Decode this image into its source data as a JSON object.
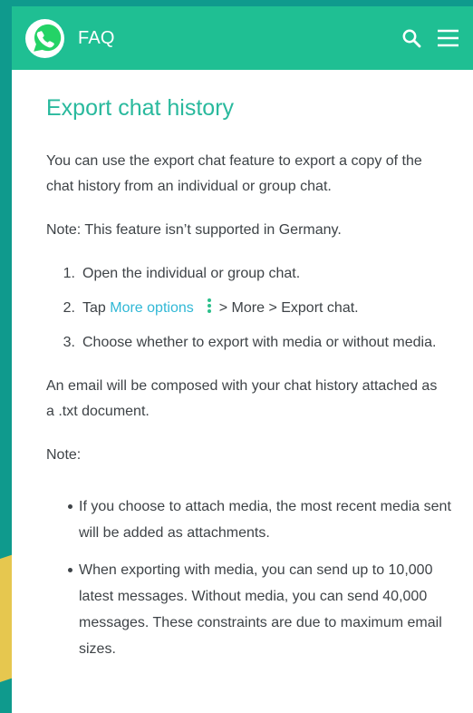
{
  "header": {
    "faq_label": "FAQ",
    "icons": {
      "logo": "whatsapp-logo-icon",
      "search": "search-icon",
      "menu": "menu-icon"
    }
  },
  "article": {
    "title": "Export chat history",
    "intro": "You can use the export chat feature to export a copy of the chat history from an individual or group chat.",
    "note_germany": "Note: This feature isn’t supported in Germany.",
    "steps": [
      {
        "number": "1.",
        "text": "Open the individual or group chat."
      },
      {
        "number": "2.",
        "prefix": "Tap ",
        "link": "More options",
        "suffix": "> More > Export chat."
      },
      {
        "number": "3.",
        "text": "Choose whether to export with media or without media."
      }
    ],
    "email_paragraph": "An email will be composed with your chat history attached as a .txt document.",
    "note_label": "Note:",
    "notes": [
      "If you choose to attach media, the most recent media sent will be added as attachments.",
      "When exporting with media, you can send up to 10,000 latest messages. Without media, you can send 40,000 messages. These constraints are due to maximum email sizes."
    ]
  },
  "colors": {
    "header_green": "#1fbf93",
    "title_teal": "#29b99d",
    "link_blue": "#31b8d6",
    "background_teal": "#0f9a8d",
    "accent_yellow": "#f2c94c"
  }
}
